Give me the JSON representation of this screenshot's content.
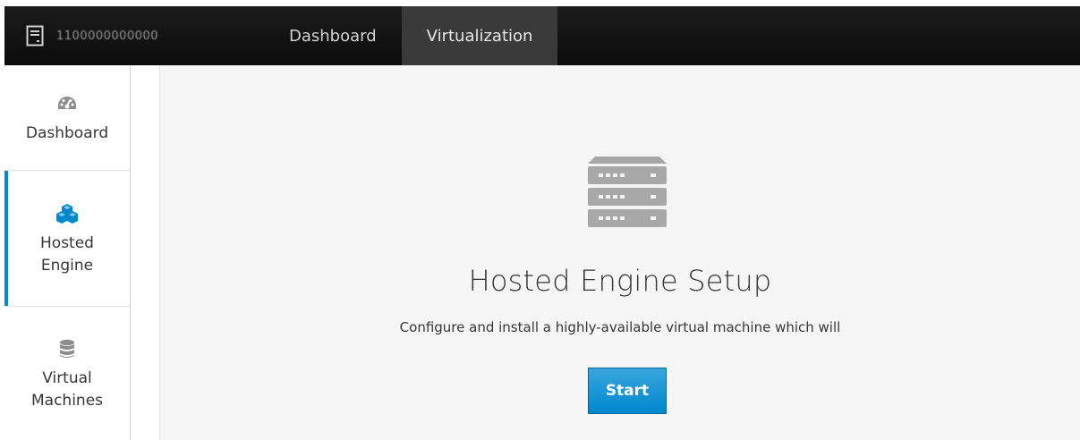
{
  "topbar": {
    "host_name": "1100000000000",
    "tabs": [
      {
        "label": "Dashboard",
        "active": false
      },
      {
        "label": "Virtualization",
        "active": true
      }
    ]
  },
  "sidebar": {
    "items": [
      {
        "label": "Dashboard",
        "icon": "dashboard-gauge-icon"
      },
      {
        "label_line1": "Hosted",
        "label_line2": "Engine",
        "icon": "cubes-icon",
        "active": true
      },
      {
        "label_line1": "Virtual",
        "label_line2": "Machines",
        "icon": "database-icon"
      }
    ]
  },
  "main": {
    "icon": "server-rack-icon",
    "title": "Hosted Engine Setup",
    "description": "Configure and install a highly-available virtual machine which will",
    "start_label": "Start"
  },
  "colors": {
    "accent": "#0088ce",
    "topbar": "#111111",
    "main_bg": "#f5f5f5"
  }
}
